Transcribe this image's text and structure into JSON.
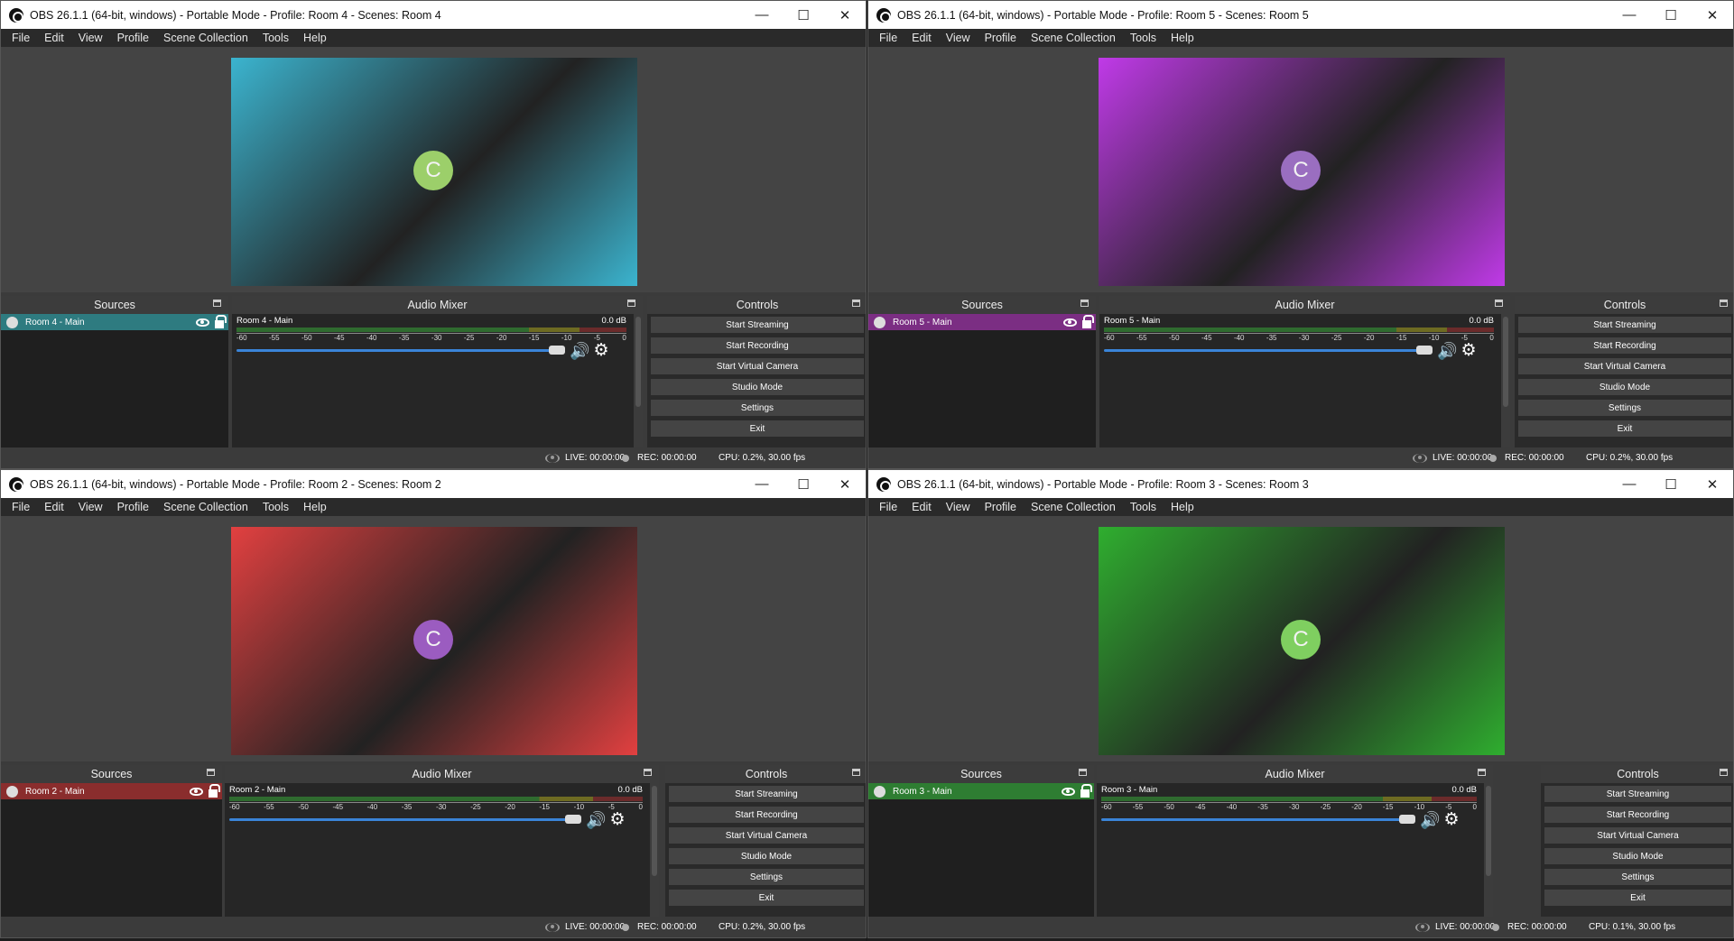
{
  "windows": [
    {
      "title": "OBS 26.1.1 (64-bit, windows) - Portable Mode - Profile: Room 4 - Scenes: Room 4",
      "source_name": "Room 4 - Main",
      "accent": "#2e7b80",
      "preview_tint": "#3bb4cf",
      "cam_color": "#9ccf6a"
    },
    {
      "title": "OBS 26.1.1 (64-bit, windows) - Portable Mode - Profile: Room 5 - Scenes: Room 5",
      "source_name": "Room 5 - Main",
      "accent": "#7b2e83",
      "preview_tint": "#c03ae8",
      "cam_color": "#9a6ec0"
    },
    {
      "title": "OBS 26.1.1 (64-bit, windows) - Portable Mode - Profile: Room 2 - Scenes: Room 2",
      "source_name": "Room 2 - Main",
      "accent": "#8a2d2d",
      "preview_tint": "#e24040",
      "cam_color": "#9b5cc0"
    },
    {
      "title": "OBS 26.1.1 (64-bit, windows) - Portable Mode - Profile: Room 3 - Scenes: Room 3",
      "source_name": "Room 3 - Main",
      "accent": "#2e7d32",
      "preview_tint": "#2fae2f",
      "cam_color": "#7fcf60"
    }
  ],
  "menu": [
    "File",
    "Edit",
    "View",
    "Profile",
    "Scene Collection",
    "Tools",
    "Help"
  ],
  "docks": {
    "sources": "Sources",
    "mixer": "Audio Mixer",
    "controls": "Controls"
  },
  "mixer": {
    "db": "0.0 dB",
    "ticks": [
      "-60",
      "-55",
      "-50",
      "-45",
      "-40",
      "-35",
      "-30",
      "-25",
      "-20",
      "-15",
      "-10",
      "-5",
      "0"
    ]
  },
  "controls": [
    "Start Streaming",
    "Start Recording",
    "Start Virtual Camera",
    "Studio Mode",
    "Settings",
    "Exit"
  ],
  "status": {
    "live": "LIVE: 00:00:00",
    "rec": "REC: 00:00:00",
    "cpu": [
      "CPU: 0.2%, 30.00 fps",
      "CPU: 0.2%, 30.00 fps",
      "CPU: 0.2%, 30.00 fps",
      "CPU: 0.1%, 30.00 fps"
    ]
  },
  "window_controls": {
    "minimize": "—",
    "maximize": "☐",
    "close": "✕"
  },
  "cam_letter": "C"
}
